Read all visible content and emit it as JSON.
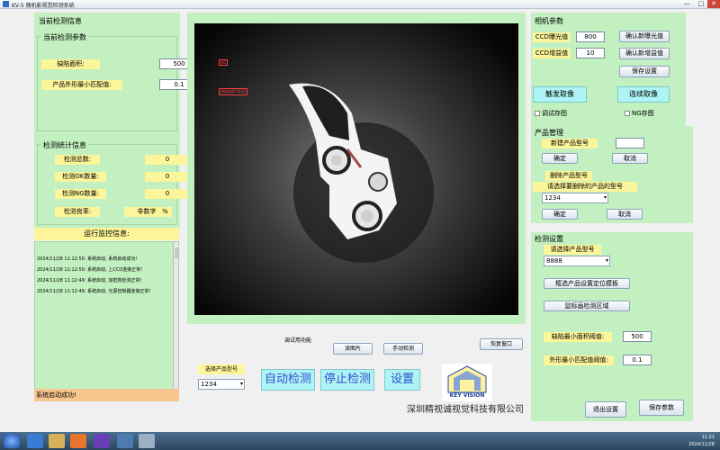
{
  "window": {
    "title": "KV-5 随机影视觉检测系统",
    "min": "—",
    "max": "□",
    "close": "✕"
  },
  "left": {
    "header": "当前检测信息",
    "params_group": "当前检测参数",
    "defect_area_label": "缺陷面积:",
    "defect_area_value": "500",
    "shape_min_match_label": "产品外形最小匹配值:",
    "shape_min_match_value": "0.1",
    "stats_group": "检测统计信息",
    "total_label": "检测总数:",
    "total_value": "0",
    "ok_label": "检测OK数量:",
    "ok_value": "0",
    "ng_label": "检测NG数量:",
    "ng_value": "0",
    "yield_label": "检测良率:",
    "yield_value": "非数字",
    "yield_unit": "%",
    "log_title": "运行监控信息:",
    "log_lines": [
      "2024/11/28 11:12:50: 系统启动, 系统启动成功!",
      "2024/11/28 11:12:50: 系统启动, 上CCD连接正常!",
      "2024/11/28 11:12:49: 系统启动, 加密狗检测正常!",
      "2024/11/28 11:12:49: 系统启动, 光源控制器连接正常!"
    ],
    "status": "系统启动成功!"
  },
  "viewer": {
    "annot1": "NG",
    "annot2": "缺陷面积:1634"
  },
  "center": {
    "debug_label": "调试用功能",
    "read_image_btn": "读图片",
    "manual_detect_btn": "手动检测",
    "restore_window_btn": "恢复窗口",
    "select_model_label": "选择产品型号",
    "select_model_value": "1234",
    "auto_detect_btn": "自动检测",
    "stop_detect_btn": "停止检测",
    "settings_btn": "设置",
    "logo_text": "KEY VISION",
    "company": "深圳精视诚视觉科技有限公司"
  },
  "camera": {
    "header": "相机参数",
    "exposure_label": "CCD曝光值",
    "exposure_value": "800",
    "confirm_exposure_btn": "确认新曝光值",
    "gain_label": "CCD增益值",
    "gain_value": "10",
    "confirm_gain_btn": "确认新增益值",
    "save_settings_btn": "保存设置",
    "trigger_btn": "触发取像",
    "continuous_btn": "连续取像",
    "debug_save_chk": "调试存图",
    "ng_save_chk": "NG存图"
  },
  "product": {
    "header": "产品管理",
    "new_model_label": "新建产品型号",
    "new_model_value": "",
    "confirm_btn": "确定",
    "cancel_btn": "取消",
    "delete_label": "删除产品型号",
    "delete_hint": "请选择要删除的产品的型号",
    "delete_select_value": "1234",
    "confirm_btn2": "确定",
    "cancel_btn2": "取消"
  },
  "detect": {
    "header": "检测设置",
    "select_model_label": "请选择产品型号",
    "select_model_value": "8888",
    "template_btn": "框选产品设置定位模板",
    "region_btn": "鼠标画检测区域",
    "defect_min_label": "缺陷最小面积阈值:",
    "defect_min_value": "500",
    "shape_min_label": "外形最小匹配值阈值:",
    "shape_min_value": "0.1",
    "exit_btn": "退出设置",
    "save_btn": "保存参数"
  },
  "tray": {
    "time": "11:21",
    "date": "2024/11/28"
  },
  "colors": {
    "panel_green": "#c2f0c0",
    "label_yellow": "#fcf59a",
    "button_cyan": "#aef4f4",
    "status_orange": "#f7c68f"
  }
}
